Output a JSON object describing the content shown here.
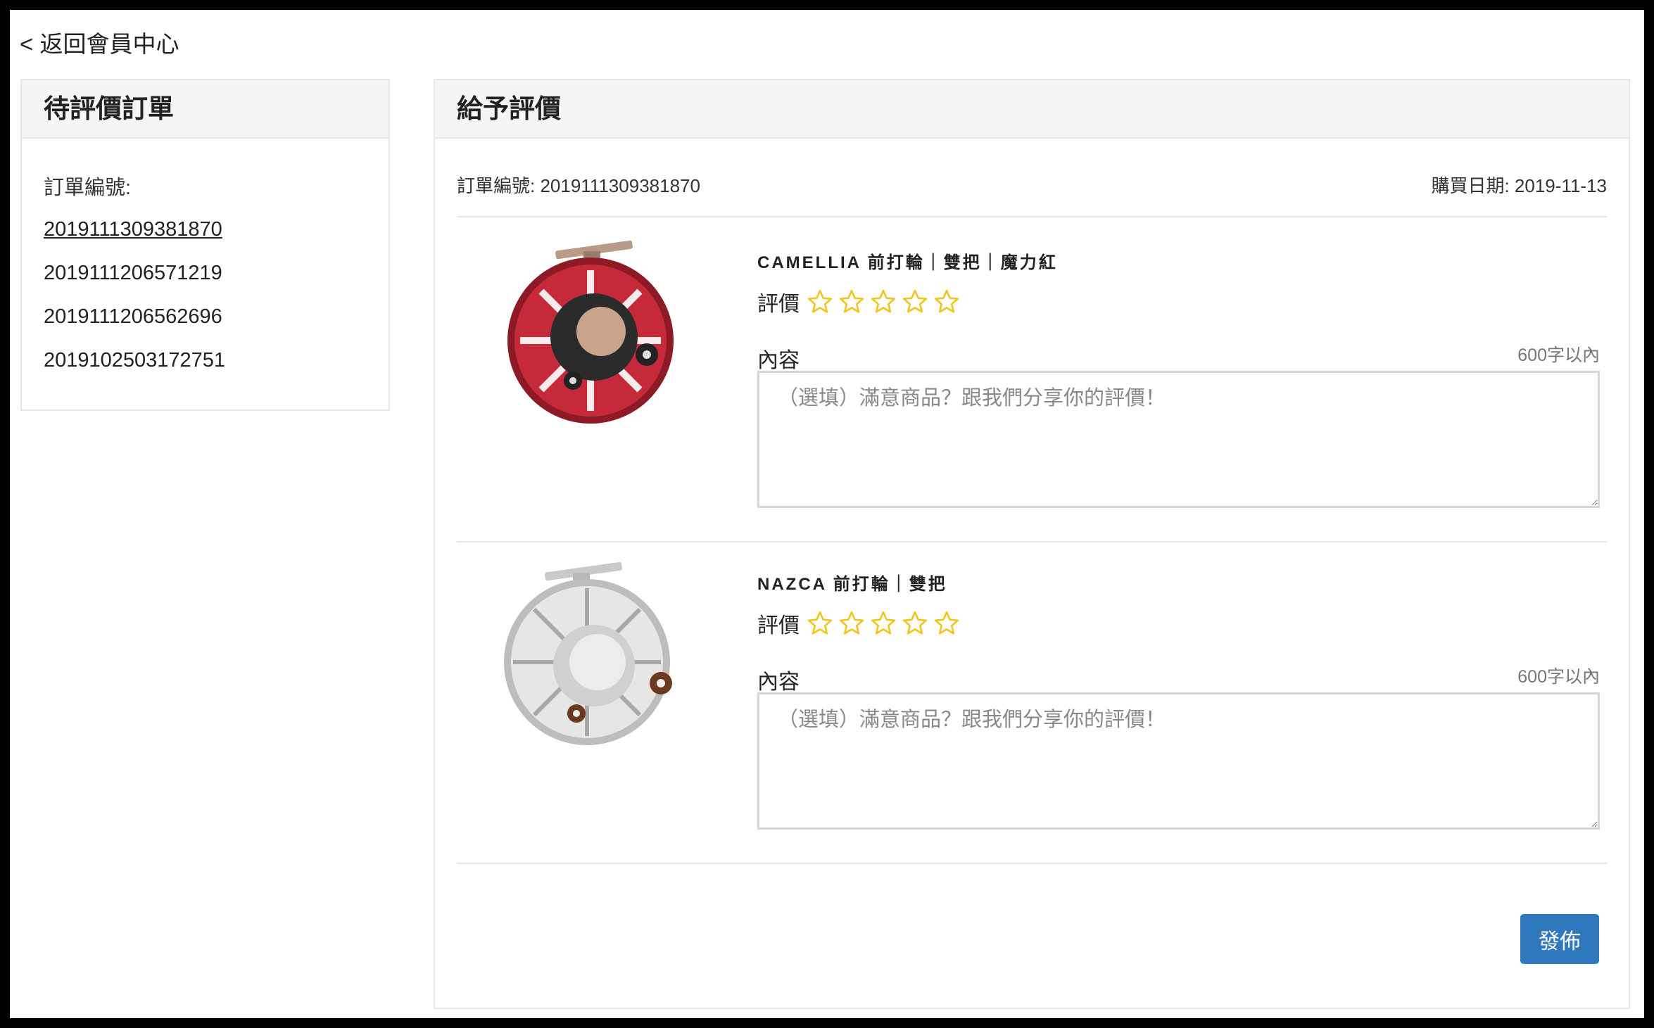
{
  "nav": {
    "back_label": "< 返回會員中心"
  },
  "sidebar": {
    "title": "待評價訂單",
    "order_label": "訂單編號:",
    "orders": [
      "2019111309381870",
      "2019111206571219",
      "2019111206562696",
      "2019102503172751"
    ]
  },
  "main": {
    "title": "給予評價",
    "order_no": "訂單編號: 2019111309381870",
    "purchase_date": "購買日期: 2019-11-13",
    "products": [
      {
        "name": "CAMELLIA 前打輪｜雙把｜魔力紅",
        "rating_label": "評價",
        "rating": 0,
        "content_label": "內容",
        "limit": "600字以內",
        "placeholder": "（選填）滿意商品？跟我們分享你的評價！",
        "image": "red-fly-reel-image"
      },
      {
        "name": "NAZCA 前打輪｜雙把",
        "rating_label": "評價",
        "rating": 0,
        "content_label": "內容",
        "limit": "600字以內",
        "placeholder": "（選填）滿意商品？跟我們分享你的評價！",
        "image": "silver-fly-reel-image"
      }
    ],
    "publish_label": "發佈"
  },
  "colors": {
    "accent": "#2f78be",
    "star": "#f0c419"
  }
}
